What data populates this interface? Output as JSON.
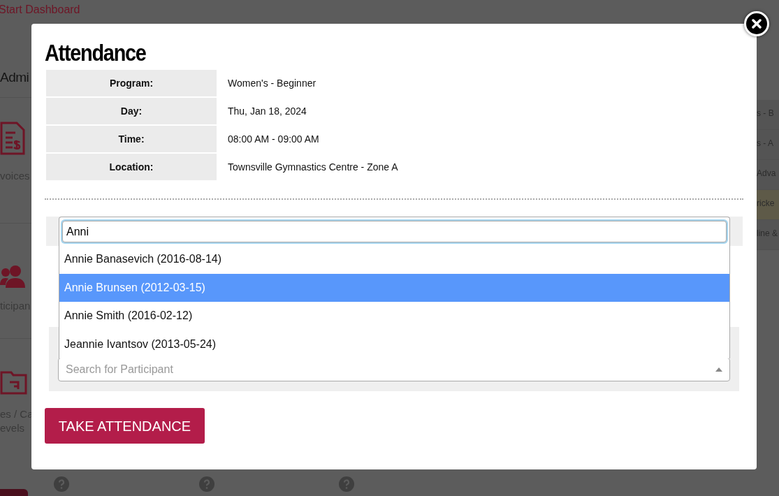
{
  "background": {
    "header_link": "Start Dashboard",
    "section_title": "Admi",
    "tiles": [
      {
        "label_lines": [
          "voices"
        ]
      },
      {
        "label_lines": [
          "ticipan"
        ]
      },
      {
        "label_lines": [
          "es / Ca",
          "evels"
        ]
      }
    ],
    "side_list": [
      {
        "label": "s - B",
        "highlighted": false
      },
      {
        "label": "s - A",
        "highlighted": false
      },
      {
        "label": "Adva",
        "highlighted": false
      },
      {
        "label": "ricke",
        "highlighted": true
      },
      {
        "label": "line &",
        "highlighted": false
      }
    ]
  },
  "modal": {
    "title": "Attendance",
    "details": [
      {
        "label": "Program:",
        "value": "Women's - Beginner"
      },
      {
        "label": "Day:",
        "value": "Thu, Jan 18, 2024"
      },
      {
        "label": "Time:",
        "value": "08:00 AM - 09:00 AM"
      },
      {
        "label": "Location:",
        "value": "Townsville Gymnastics Centre - Zone A"
      }
    ],
    "participant_select": {
      "search_value": "Anni",
      "placeholder": "Search for Participant",
      "options": [
        {
          "label": "Annie Banasevich (2016-08-14)",
          "selected": false
        },
        {
          "label": "Annie Brunsen (2012-03-15)",
          "selected": true
        },
        {
          "label": "Annie Smith (2016-02-12)",
          "selected": false
        },
        {
          "label": "Jeannie Ivantsov (2013-05-24)",
          "selected": false
        }
      ]
    },
    "button": "TAKE ATTENDANCE"
  }
}
